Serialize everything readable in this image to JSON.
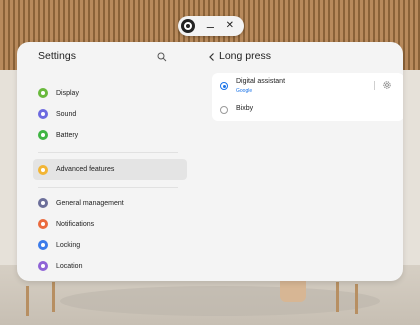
{
  "window_controls": {
    "minimize": "–",
    "close": "✕"
  },
  "sidebar": {
    "title": "Settings",
    "items": [
      {
        "label": "Display",
        "icon": "display-icon",
        "color": "#69b93c"
      },
      {
        "label": "Sound",
        "icon": "sound-icon",
        "color": "#6d6ae0"
      },
      {
        "label": "Battery",
        "icon": "battery-icon",
        "color": "#3fb543"
      },
      {
        "label": "Advanced features",
        "icon": "advanced-features-icon",
        "color": "#f2b535",
        "active": true
      },
      {
        "label": "General management",
        "icon": "general-management-icon",
        "color": "#6c6f9a"
      },
      {
        "label": "Notifications",
        "icon": "notifications-icon",
        "color": "#ea6a3d"
      },
      {
        "label": "Locking",
        "icon": "locking-icon",
        "color": "#3b7bea"
      },
      {
        "label": "Location",
        "icon": "location-icon",
        "color": "#8f63d6"
      }
    ]
  },
  "detail": {
    "title": "Long press",
    "options": [
      {
        "label": "Digital assistant",
        "sublabel": "Google",
        "selected": true
      },
      {
        "label": "Bixby",
        "selected": false
      }
    ]
  },
  "colors": {
    "accent": "#1a73e8",
    "panel": "#f4f4f4"
  }
}
